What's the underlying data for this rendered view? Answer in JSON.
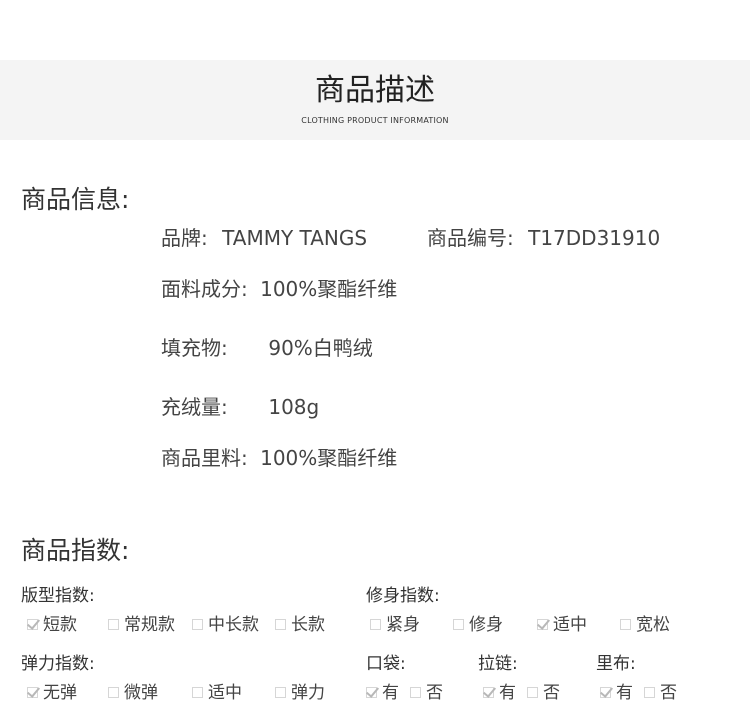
{
  "header": {
    "title": "商品描述",
    "subtitle": "CLOTHING PRODUCT INFORMATION"
  },
  "info": {
    "section_title": "商品信息:",
    "brand_label": "品牌:",
    "brand_value": "TAMMY TANGS",
    "code_label": "商品编号:",
    "code_value": "T17DD31910",
    "fabric_label": "面料成分:",
    "fabric_value": "100%聚酯纤维",
    "filling_label": "填充物:",
    "filling_value": "90%白鸭绒",
    "down_label": "充绒量:",
    "down_value": "108g",
    "lining_label": "商品里料:",
    "lining_value": "100%聚酯纤维"
  },
  "index": {
    "section_title": "商品指数:",
    "fit": {
      "label": "版型指数:",
      "options": [
        "短款",
        "常规款",
        "中长款",
        "长款"
      ],
      "selected": "短款"
    },
    "body": {
      "label": "修身指数:",
      "options": [
        "紧身",
        "修身",
        "适中",
        "宽松"
      ],
      "selected": "适中"
    },
    "elastic": {
      "label": "弹力指数:",
      "options": [
        "无弹",
        "微弹",
        "适中",
        "弹力"
      ],
      "selected": "无弹"
    },
    "pocket": {
      "label": "口袋:",
      "options": [
        "有",
        "否"
      ],
      "selected": "有"
    },
    "zipper": {
      "label": "拉链:",
      "options": [
        "有",
        "否"
      ],
      "selected": "有"
    },
    "lining": {
      "label": "里布:",
      "options": [
        "有",
        "否"
      ],
      "selected": "有"
    }
  }
}
